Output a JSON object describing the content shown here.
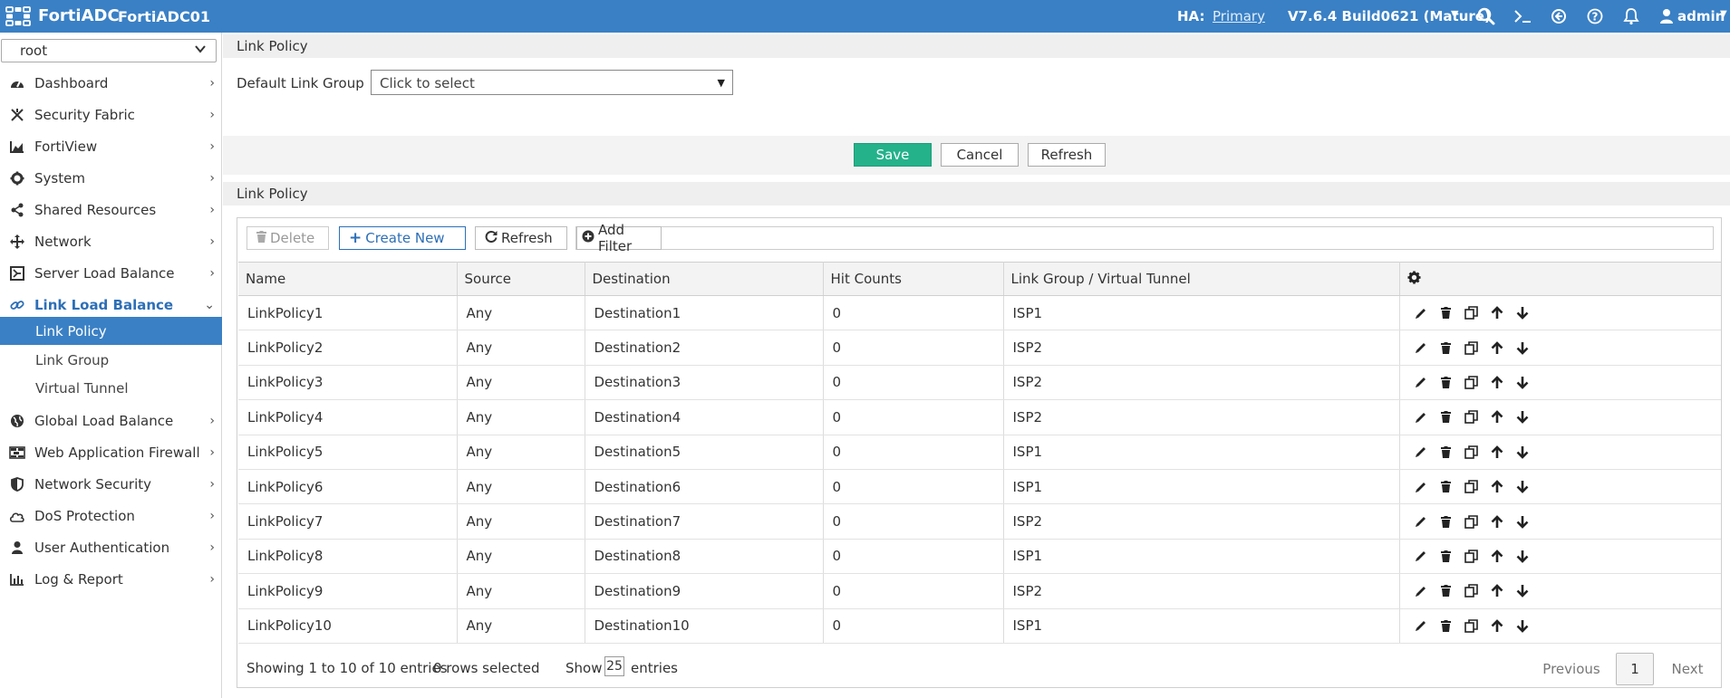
{
  "topbar": {
    "brand": "FortiADC",
    "hostname": "FortiADC01",
    "ha_label": "HA:",
    "ha_value": "Primary",
    "version": "V7.6.4 Build0621 (Mature)",
    "user": "admin",
    "icons": [
      "search-icon",
      "cli-console-icon",
      "logout-icon",
      "help-icon",
      "bell-icon",
      "user-icon"
    ]
  },
  "sidebar": {
    "vdom": "root",
    "items": [
      {
        "label": "Dashboard",
        "icon": "dashboard-icon"
      },
      {
        "label": "Security Fabric",
        "icon": "security-fabric-icon"
      },
      {
        "label": "FortiView",
        "icon": "chart-icon"
      },
      {
        "label": "System",
        "icon": "gear-icon"
      },
      {
        "label": "Shared Resources",
        "icon": "share-icon"
      },
      {
        "label": "Network",
        "icon": "network-icon"
      },
      {
        "label": "Server Load Balance",
        "icon": "server-lb-icon"
      },
      {
        "label": "Link Load Balance",
        "icon": "link-icon"
      },
      {
        "label": "Global Load Balance",
        "icon": "globe-icon"
      },
      {
        "label": "Web Application Firewall",
        "icon": "waf-icon"
      },
      {
        "label": "Network Security",
        "icon": "shield-icon"
      },
      {
        "label": "DoS Protection",
        "icon": "cloud-icon"
      },
      {
        "label": "User Authentication",
        "icon": "user-icon"
      },
      {
        "label": "Log & Report",
        "icon": "report-icon"
      }
    ],
    "sub_items": [
      "Link Policy",
      "Link Group",
      "Virtual Tunnel"
    ]
  },
  "settings": {
    "section_title": "Link Policy",
    "default_link_group_label": "Default Link Group",
    "default_link_group_value": "Click to select",
    "save_label": "Save",
    "cancel_label": "Cancel",
    "refresh_label": "Refresh"
  },
  "table_section": {
    "title": "Link Policy",
    "toolbar": {
      "delete_label": "Delete",
      "create_label": "Create New",
      "refresh_label": "Refresh",
      "filter_label": "Add Filter"
    },
    "columns": [
      "Name",
      "Source",
      "Destination",
      "Hit Counts",
      "Link Group / Virtual Tunnel"
    ],
    "rows": [
      [
        "LinkPolicy1",
        "Any",
        "Destination1",
        "0",
        "ISP1"
      ],
      [
        "LinkPolicy2",
        "Any",
        "Destination2",
        "0",
        "ISP2"
      ],
      [
        "LinkPolicy3",
        "Any",
        "Destination3",
        "0",
        "ISP2"
      ],
      [
        "LinkPolicy4",
        "Any",
        "Destination4",
        "0",
        "ISP2"
      ],
      [
        "LinkPolicy5",
        "Any",
        "Destination5",
        "0",
        "ISP1"
      ],
      [
        "LinkPolicy6",
        "Any",
        "Destination6",
        "0",
        "ISP1"
      ],
      [
        "LinkPolicy7",
        "Any",
        "Destination7",
        "0",
        "ISP2"
      ],
      [
        "LinkPolicy8",
        "Any",
        "Destination8",
        "0",
        "ISP1"
      ],
      [
        "LinkPolicy9",
        "Any",
        "Destination9",
        "0",
        "ISP2"
      ],
      [
        "LinkPolicy10",
        "Any",
        "Destination10",
        "0",
        "ISP1"
      ]
    ],
    "footer": {
      "showing": "Showing 1 to 10 of 10 entries",
      "selected": "0 rows selected",
      "show_label": "Show",
      "page_size": "25",
      "entries_label": "entries",
      "previous": "Previous",
      "current_page": "1",
      "next": "Next"
    }
  },
  "colors": {
    "topbar": "#3a80c5",
    "save_button": "#24b28b",
    "active_nav": "#2d6fb7"
  }
}
